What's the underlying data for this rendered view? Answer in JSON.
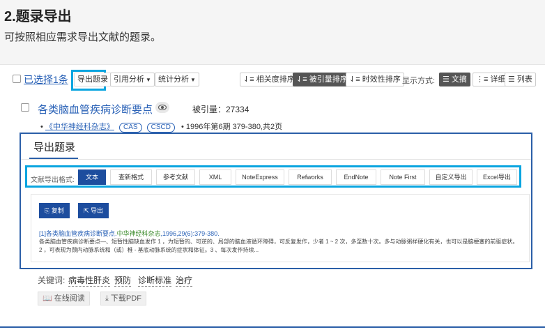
{
  "doc": {
    "title": "2.题录导出",
    "subtitle": "可按照相应需求导出文献的题录。"
  },
  "toolbar": {
    "selected": "已选择1条",
    "export": "导出题录",
    "cite_analysis": "引用分析",
    "stat_analysis": "统计分析",
    "sort_relevance": "相关度排序",
    "sort_cited": "被引量排序",
    "sort_time": "时效性排序",
    "display_label": "显示方式:",
    "view_abstract": "文摘",
    "view_detail": "详细",
    "view_list": "列表"
  },
  "result": {
    "title": "各类脑血管疾病诊断要点",
    "cite_count": "被引量：27334",
    "journal": "《中华神经科杂志》",
    "tags": [
      "CAS",
      "CSCD"
    ],
    "issue": "• 1996年第6期 379-380,共2页",
    "keywords_label": "关键词:",
    "keywords": [
      "病毒性肝炎",
      "预防",
      "诊断标准",
      "治疗"
    ],
    "read_online": "在线阅读",
    "download_pdf": "下载PDF"
  },
  "panel": {
    "tab": "导出题录",
    "format_label": "文献导出格式:",
    "formats": [
      "文本",
      "查新格式",
      "参考文献",
      "XML",
      "NoteExpress",
      "Refworks",
      "EndNote",
      "Note First",
      "自定义导出",
      "Excel导出"
    ],
    "copy": "复制",
    "export": "导出",
    "ref_prefix": "[1]各类脑血管疾病诊断要点.",
    "ref_journal": "中华神经科杂志",
    "ref_suffix": ",1996,29(6):379-380.",
    "abstract": "各类脑血管疾病诊断要点—、短暂性脑缺血发作 1 ，为短暂的、可逆的、局部的脑血液循环障碍，可反复发作，少者 1 ~ 2 次，多至数十次。多与动脉粥样硬化有关，也可以是脑梗塞的前驱症状。2 ，可表现为颈内动脉系统和（或）椎 - 基底动脉系统的症状和体征。3 、每次发作持续..."
  },
  "colors": {
    "accent": "#1d4d9e",
    "link": "#2a62b7",
    "highlight": "#0aa5e0"
  }
}
